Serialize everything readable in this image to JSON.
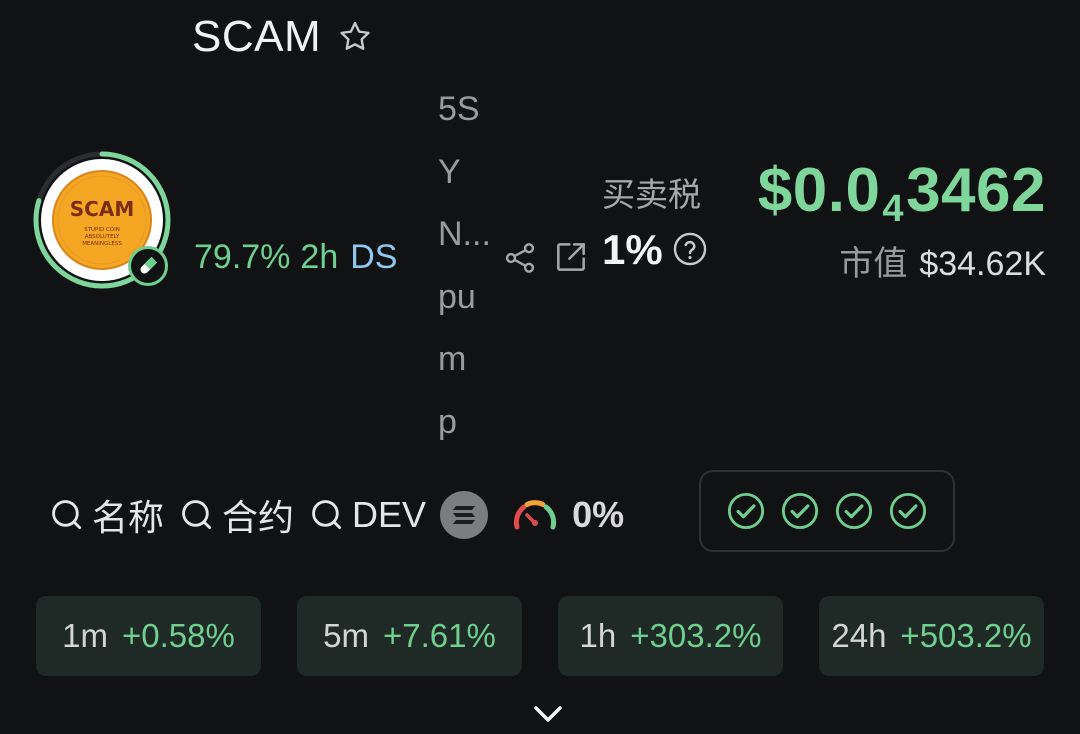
{
  "token": {
    "symbol": "SCAM",
    "logo_text": "SCAM",
    "logo_subtext_1": "STUPID COIN",
    "logo_subtext_2": "ABSOLUTELY",
    "logo_subtext_3": "MEANINGLESS",
    "bonding_progress": "79.7%",
    "bonding_progress_value": 0.797,
    "age": "2h",
    "ds_label": "DS",
    "address_lines": [
      "5S",
      "Y",
      "N...",
      "pu",
      "m",
      "p"
    ]
  },
  "tax": {
    "label": "买卖税",
    "value": "1%"
  },
  "price": {
    "prefix": "$0.0",
    "zero_count": "4",
    "suffix": "3462"
  },
  "market_cap": {
    "label": "市值",
    "value": "$34.62K"
  },
  "search": {
    "name_label": "名称",
    "contract_label": "合约",
    "dev_label": "DEV"
  },
  "risk": {
    "value": "0%"
  },
  "stats": [
    {
      "period": "1m",
      "change": "+0.58%"
    },
    {
      "period": "5m",
      "change": "+7.61%"
    },
    {
      "period": "1h",
      "change": "+303.2%"
    },
    {
      "period": "24h",
      "change": "+503.2%"
    }
  ],
  "colors": {
    "accent_green": "#6fcf8f",
    "price_green": "#7ed69b",
    "link_blue": "#8ec9f0",
    "background": "#111214",
    "stat_bg": "#1f2a26",
    "logo_orange": "#f5a623"
  },
  "icons": {
    "favorite": "star-outline-icon",
    "share": "share-icon",
    "external": "external-link-icon",
    "help": "question-circle-icon",
    "search": "search-icon",
    "chain": "solana-icon",
    "gauge": "gauge-icon",
    "check": "check-circle-icon",
    "expand": "chevron-down-icon"
  }
}
